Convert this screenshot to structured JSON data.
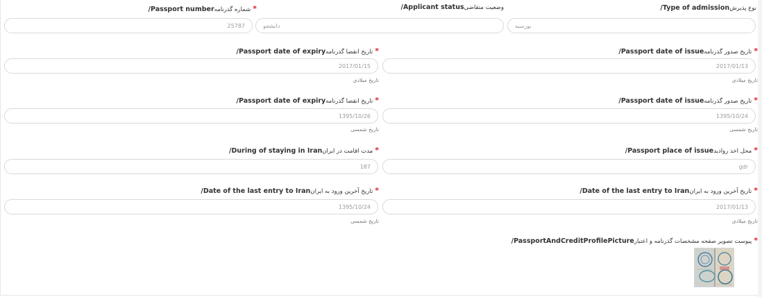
{
  "row1": {
    "passport_number": {
      "label_en": "Passport number/",
      "label_fa": "شماره گذرنامه",
      "value": "25787"
    },
    "applicant_status": {
      "label_en": "Applicant status/",
      "label_fa": "وضعیت متقاضی",
      "value": "دانشجو"
    },
    "admission_type": {
      "label_en": "Type of admission/",
      "label_fa": "نوع پذیرش",
      "value": "بورسیه"
    }
  },
  "row2": {
    "expiry": {
      "label_en": "Passport date of expiry/",
      "label_fa": "تاریخ انقضا گذرنامه",
      "value": "2017/01/15",
      "hint": "تاریخ میلادی"
    },
    "issue": {
      "label_en": "Passport date of issue/",
      "label_fa": "تاریخ صدور گذرنامه",
      "value": "2017/01/13",
      "hint": "تاریخ میلادی"
    }
  },
  "row3": {
    "expiry": {
      "label_en": "Passport date of expiry/",
      "label_fa": "تاریخ انقضا گذرنامه",
      "value": "1395/10/26",
      "hint": "تاریخ شمسی"
    },
    "issue": {
      "label_en": "Passport date of issue/",
      "label_fa": "تاریخ صدور گذرنامه",
      "value": "1395/10/24",
      "hint": "تاریخ شمسی"
    }
  },
  "row4": {
    "stay": {
      "label_en": "During of staying in Iran/",
      "label_fa": "مدت اقامت در ایران",
      "value": "187"
    },
    "place": {
      "label_en": "Passport place of issue/",
      "label_fa": "محل اخذ روادید",
      "value": "gdr"
    }
  },
  "row5": {
    "left": {
      "label_en": "Date of the last entry to Iran/",
      "label_fa": "تاریخ آخرین ورود به ایران",
      "value": "1395/10/24",
      "hint": "تاریخ شمسی"
    },
    "right": {
      "label_en": "Date of the last entry to Iran/",
      "label_fa": "تاریخ آخرین ورود به ایران",
      "value": "2017/01/13",
      "hint": "تاریخ میلادی"
    }
  },
  "attachment": {
    "label_en": "PassportAndCreditProfilePicture/",
    "label_fa": "پیوست تصویر صفحه مشخصات گذرنامه و اعتبار"
  },
  "icons": {
    "required_marker": "asterisk",
    "thumbnail": "passport-photo"
  },
  "colors": {
    "required": "#d9232e",
    "border": "#d9d9d9",
    "hint": "#777777"
  }
}
